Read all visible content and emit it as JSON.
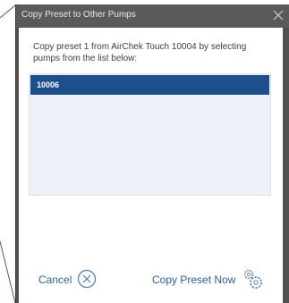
{
  "dialog": {
    "title": "Copy Preset to Other Pumps",
    "prompt": "Copy preset 1 from AirChek Touch 10004 by selecting pumps from the list below:",
    "pumps": [
      {
        "id": "10006",
        "selected": true
      }
    ],
    "cancel_label": "Cancel",
    "copy_label": "Copy Preset Now"
  },
  "icons": {
    "close": "close-icon",
    "cancel": "circle-x-icon",
    "copy": "gears-icon"
  },
  "colors": {
    "title_bar": "#5a5a5a",
    "selected_row": "#1d4f8c",
    "list_background": "#edf1f8",
    "button_text": "#2d5f9a"
  }
}
